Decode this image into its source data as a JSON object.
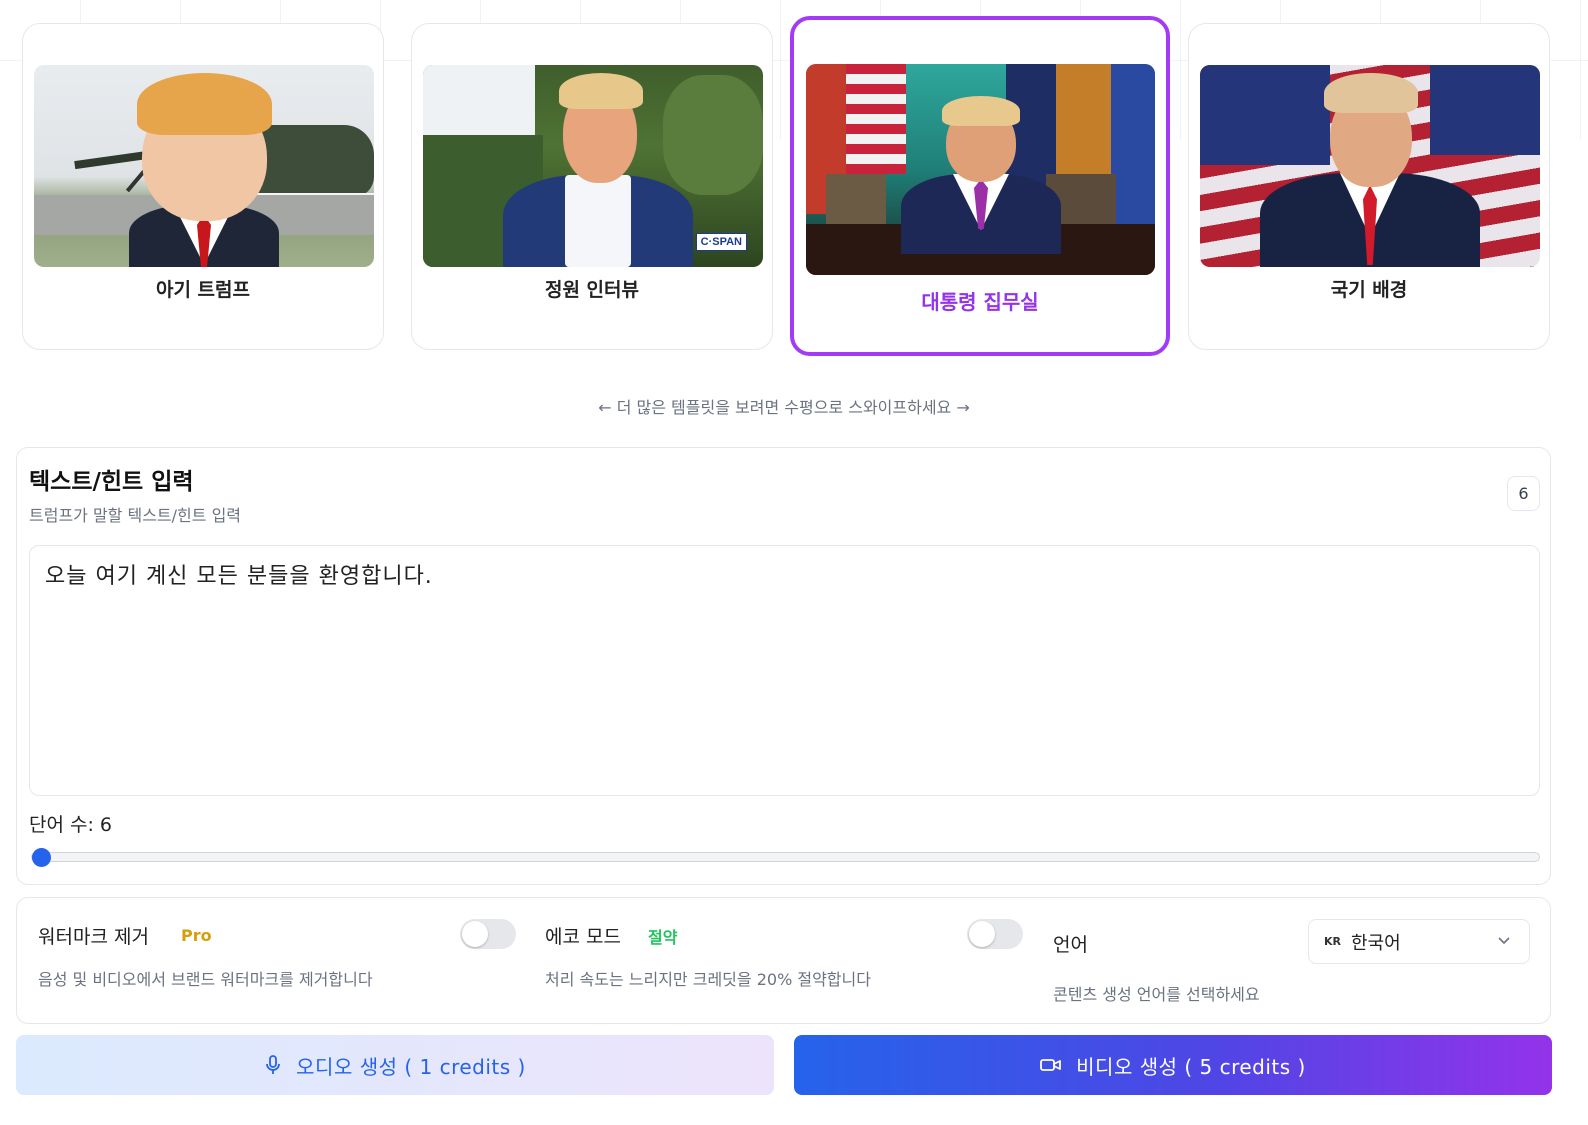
{
  "templates": [
    {
      "label": "아기 트럼프",
      "selected": false
    },
    {
      "label": "정원 인터뷰",
      "selected": false
    },
    {
      "label": "대통령 집무실",
      "selected": true
    },
    {
      "label": "국기 배경",
      "selected": false
    }
  ],
  "cspan_logo": "C·SPAN",
  "swipe_hint": "← 더 많은 템플릿을 보려면 수평으로 스와이프하세요 →",
  "text_panel": {
    "title": "텍스트/힌트 입력",
    "subtitle": "트럼프가 말할 텍스트/힌트 입력",
    "count_badge": "6",
    "text_value": "오늘 여기 계신 모든 분들을 환영합니다.",
    "word_count_label": "단어 수: 6",
    "slider_fraction": 0.006
  },
  "options": {
    "watermark": {
      "title": "워터마크 제거",
      "tag": "Pro",
      "tag_color": "#d69e0a",
      "desc": "음성 및 비디오에서 브랜드 워터마크를 제거합니다",
      "enabled": false
    },
    "eco": {
      "title": "에코 모드",
      "tag": "절약",
      "tag_color": "#22c55e",
      "desc": "처리 속도는 느리지만 크레딧을 20% 절약합니다",
      "enabled": false
    },
    "language": {
      "title": "언어",
      "desc": "콘텐츠 생성 언어를 선택하세요",
      "flag": "KR",
      "selected": "한국어"
    }
  },
  "buttons": {
    "audio": "오디오 생성 ( 1 credits )",
    "video": "비디오 생성 ( 5 credits )"
  },
  "colors": {
    "accent_purple": "#a33bf6",
    "primary_blue": "#2563eb"
  },
  "icons": [
    "mic-icon",
    "video-camera-icon",
    "chevron-down-icon",
    "arrow-left",
    "arrow-right"
  ]
}
